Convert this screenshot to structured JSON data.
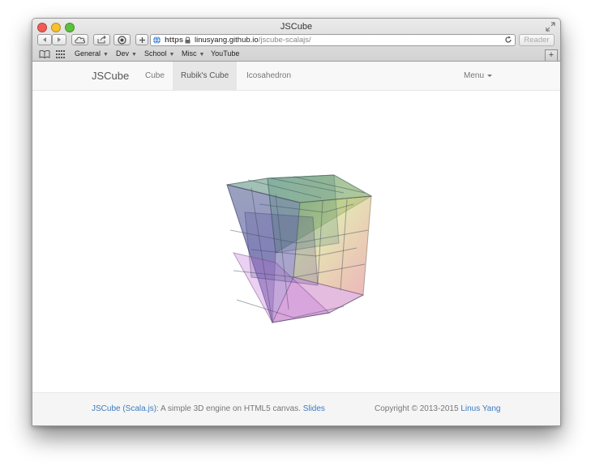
{
  "window": {
    "title": "JSCube"
  },
  "address_bar": {
    "scheme": "https",
    "domain": "linusyang.github.io",
    "path": "/jscube-scalajs/"
  },
  "toolbar": {
    "reader_label": "Reader"
  },
  "bookmarks": [
    {
      "label": "General",
      "has_menu": true
    },
    {
      "label": "Dev",
      "has_menu": true
    },
    {
      "label": "School",
      "has_menu": true
    },
    {
      "label": "Misc",
      "has_menu": true
    },
    {
      "label": "YouTube",
      "has_menu": false
    }
  ],
  "navbar": {
    "brand": "JSCube",
    "links": [
      {
        "label": "Cube",
        "active": false
      },
      {
        "label": "Rubik's Cube",
        "active": true
      },
      {
        "label": "Icosahedron",
        "active": false
      }
    ],
    "menu_label": "Menu"
  },
  "footer": {
    "project_link": "JSCube (Scala.js)",
    "description": ": A simple 3D engine on HTML5 canvas. ",
    "slides_link": "Slides",
    "copyright": "Copyright © 2013-2015 ",
    "author_link": "Linus Yang"
  },
  "icons": [
    "back-icon",
    "forward-icon",
    "cloud-icon",
    "share-icon",
    "shield-icon",
    "plus-icon",
    "globe-icon",
    "lock-icon",
    "reload-icon",
    "book-icon",
    "grid-icon",
    "fullscreen-icon"
  ],
  "colors": {
    "accent_link": "#3b7bbf",
    "active_tab_bg": "#e7e7e7"
  }
}
